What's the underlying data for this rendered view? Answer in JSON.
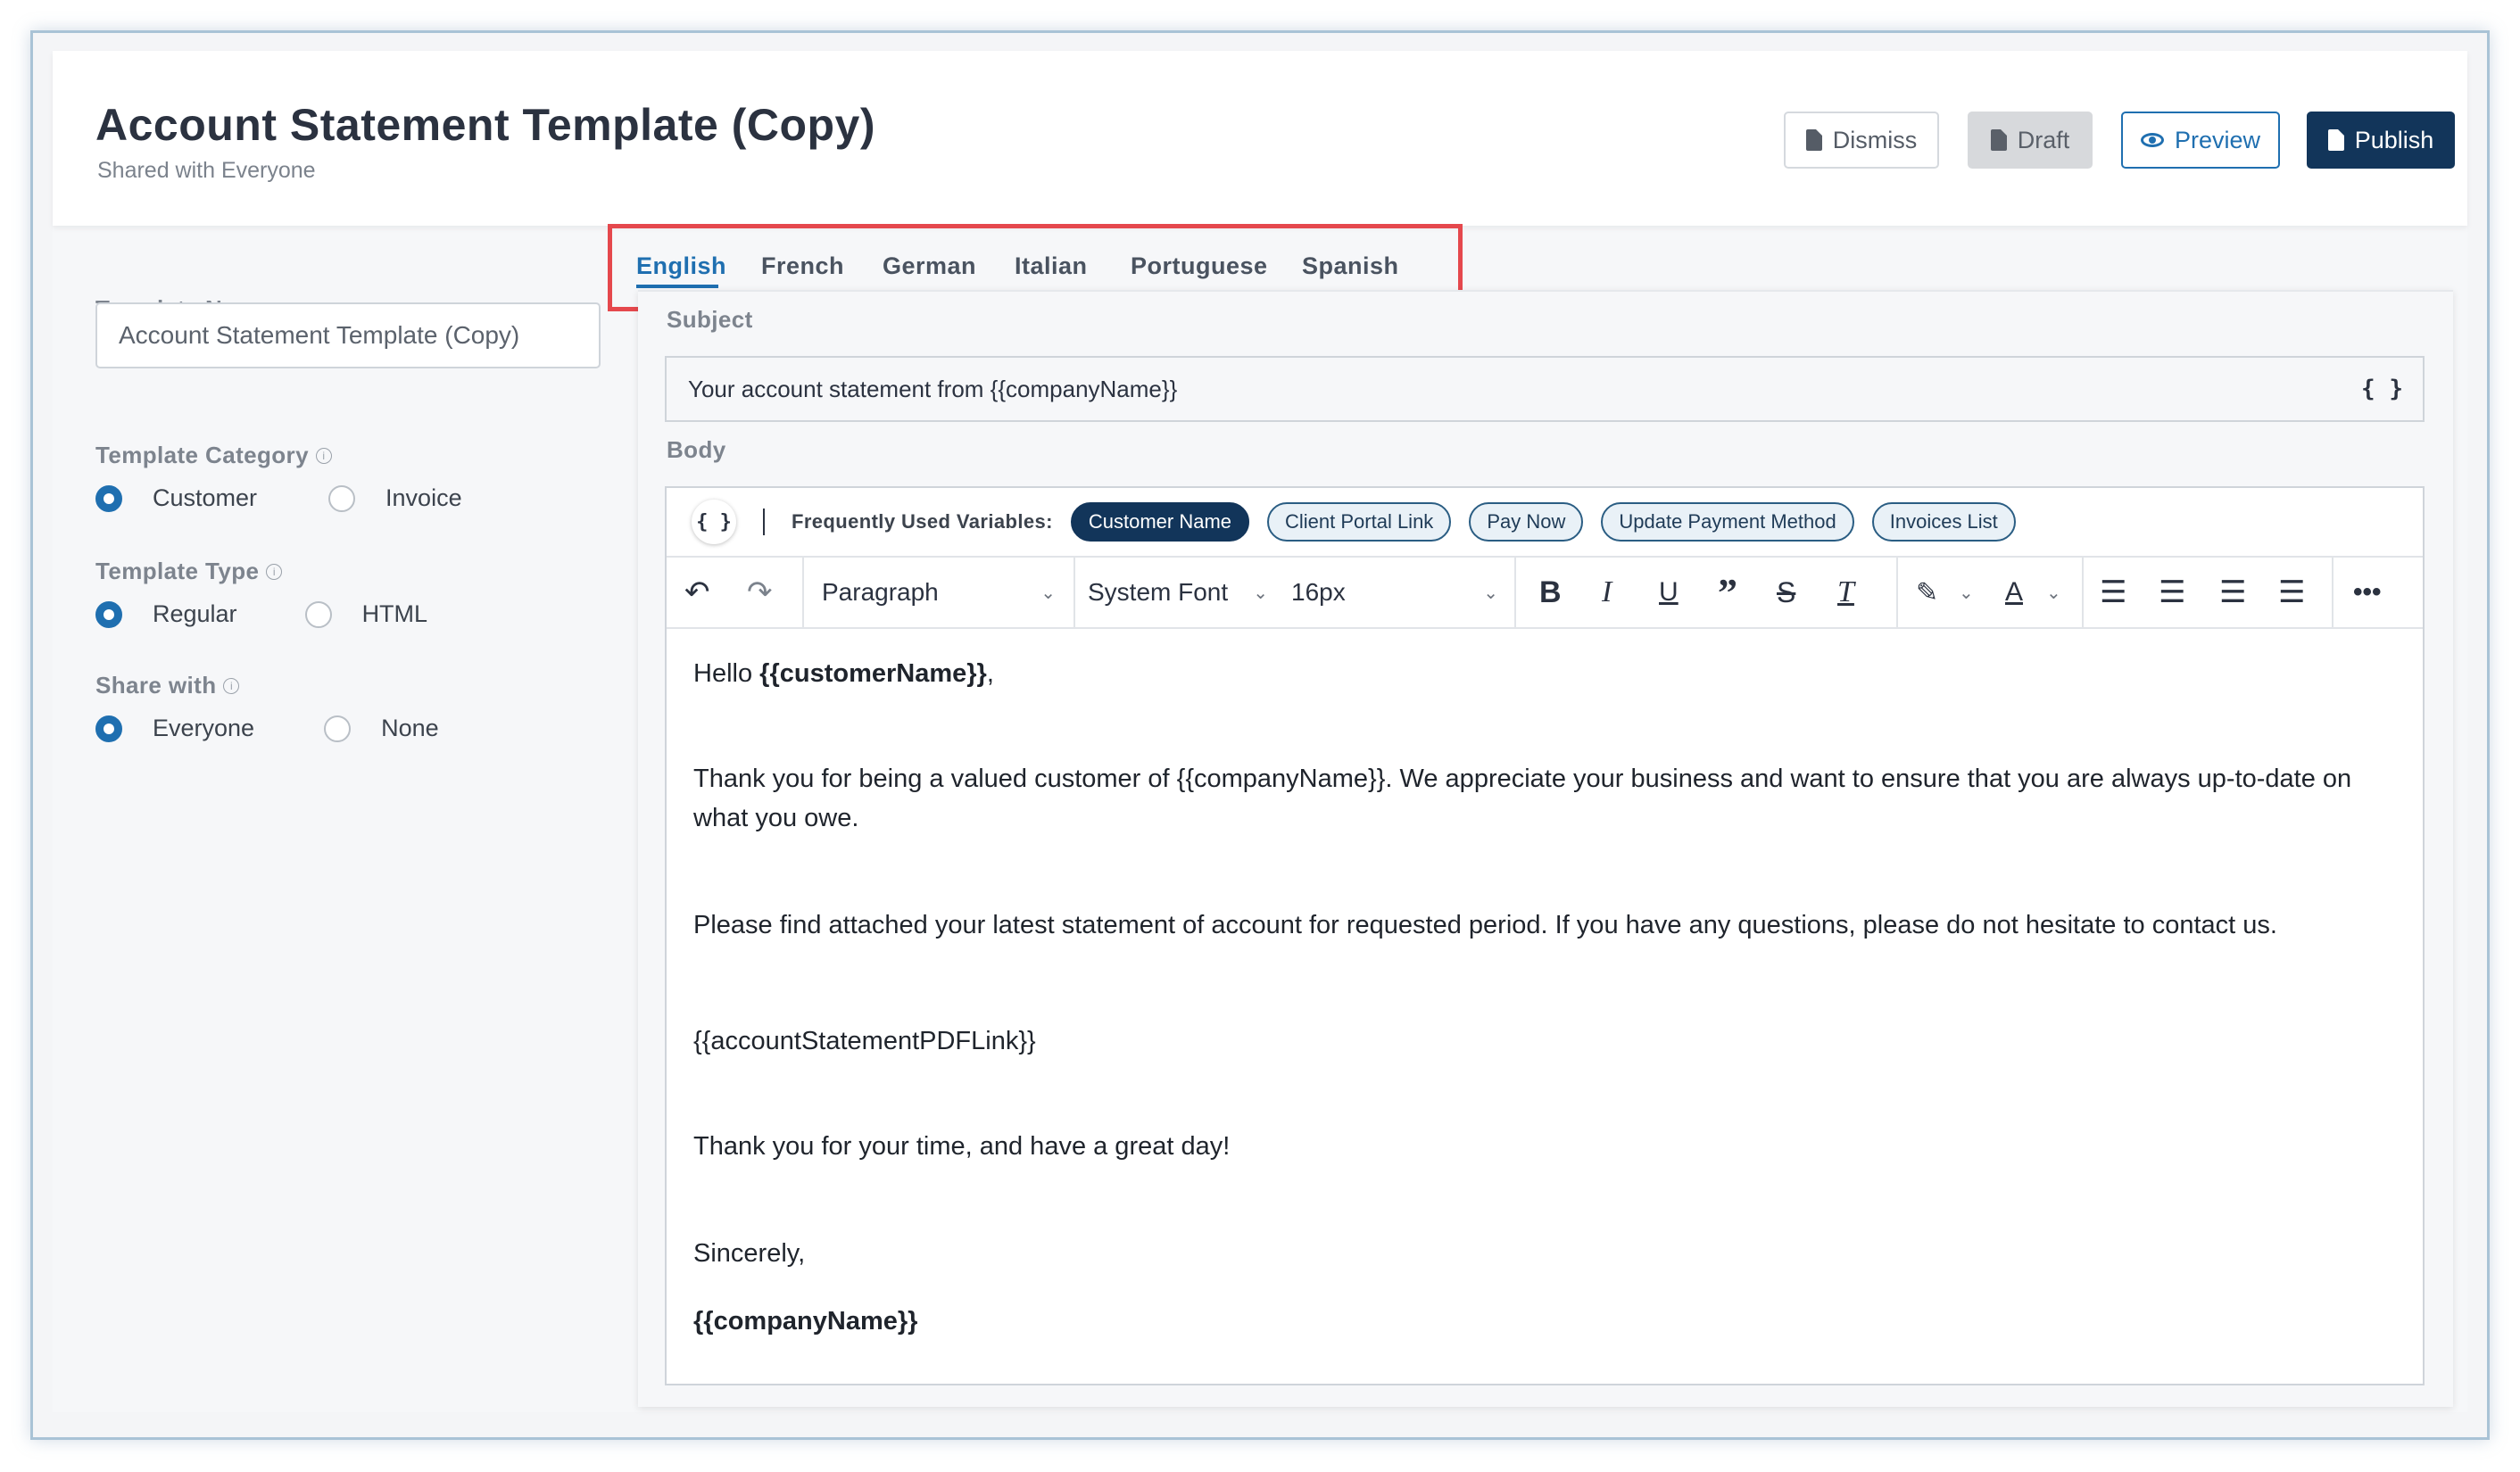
{
  "header": {
    "title": "Account Statement Template (Copy)",
    "subtitle": "Shared with Everyone",
    "dismiss_label": "Dismiss",
    "draft_label": "Draft",
    "preview_label": "Preview",
    "publish_label": "Publish"
  },
  "form": {
    "template_name_label": "Template Name",
    "template_name_value": "Account Statement Template (Copy)",
    "category_label": "Template Category",
    "category_options": [
      "Customer",
      "Invoice"
    ],
    "category_selected": "Customer",
    "type_label": "Template Type",
    "type_options": [
      "Regular",
      "HTML"
    ],
    "type_selected": "Regular",
    "share_label": "Share with",
    "share_options": [
      "Everyone",
      "None"
    ],
    "share_selected": "Everyone"
  },
  "tabs": [
    "English",
    "French",
    "German",
    "Italian",
    "Portuguese",
    "Spanish"
  ],
  "active_tab": "English",
  "editor": {
    "subject_label": "Subject",
    "subject_value": "Your account statement from {{companyName}}",
    "variables_button": "{ }",
    "body_label": "Body",
    "frequent_vars_label": "Frequently Used Variables:",
    "variables": [
      "Customer Name",
      "Client Portal Link",
      "Pay Now",
      "Update Payment Method",
      "Invoices List"
    ],
    "block_format": "Paragraph",
    "font_family": "System Font",
    "font_size": "16px",
    "body": {
      "greeting_prefix": "Hello ",
      "greeting_var": "{{customerName}}",
      "greeting_suffix": ",",
      "para1": "Thank you for being a valued customer of {{companyName}}. We appreciate your business and want to ensure that you are always up-to-date on what you owe.",
      "para2": "Please find attached your latest statement of account for requested period. If you have any questions, please do not hesitate to contact us.",
      "pdf_link": "{{accountStatementPDFLink}}",
      "closing": "Thank you for your time, and have a great day!",
      "sign_off": "Sincerely,",
      "signature": "{{companyName}}"
    }
  },
  "colors": {
    "primary": "#1f6fb0",
    "publish": "#12355a",
    "highlight_box": "#e5484d"
  }
}
